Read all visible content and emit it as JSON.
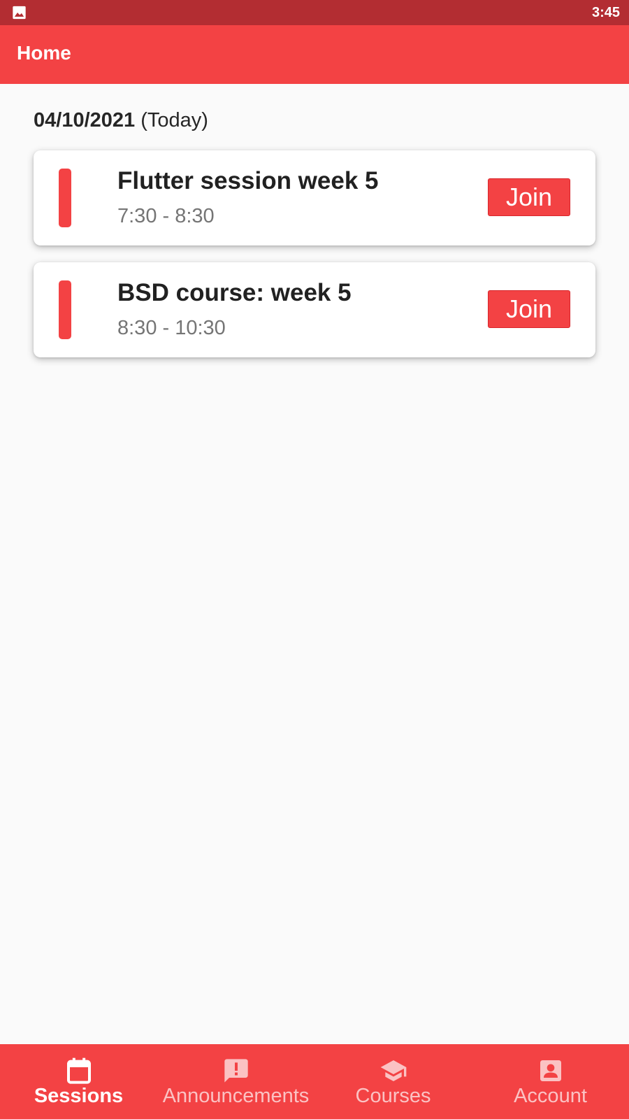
{
  "status_bar": {
    "time": "3:45",
    "icons": [
      "image-icon"
    ]
  },
  "app_bar": {
    "title": "Home"
  },
  "schedule": {
    "date": "04/10/2021",
    "relative_label": "(Today)",
    "sessions": [
      {
        "title": "Flutter session week 5",
        "time": "7:30 - 8:30",
        "join_label": "Join"
      },
      {
        "title": "BSD course: week 5",
        "time": "8:30 - 10:30",
        "join_label": "Join"
      }
    ]
  },
  "bottom_nav": {
    "items": [
      {
        "label": "Sessions",
        "icon": "calendar-icon",
        "active": true
      },
      {
        "label": "Announcements",
        "icon": "announcement-icon",
        "active": false
      },
      {
        "label": "Courses",
        "icon": "school-icon",
        "active": false
      },
      {
        "label": "Account",
        "icon": "account-box-icon",
        "active": false
      }
    ]
  },
  "colors": {
    "primary": "#f34244",
    "status_bar": "#b32d32",
    "background": "#fafafa",
    "inactive_nav_label": "#fbc2c3"
  }
}
